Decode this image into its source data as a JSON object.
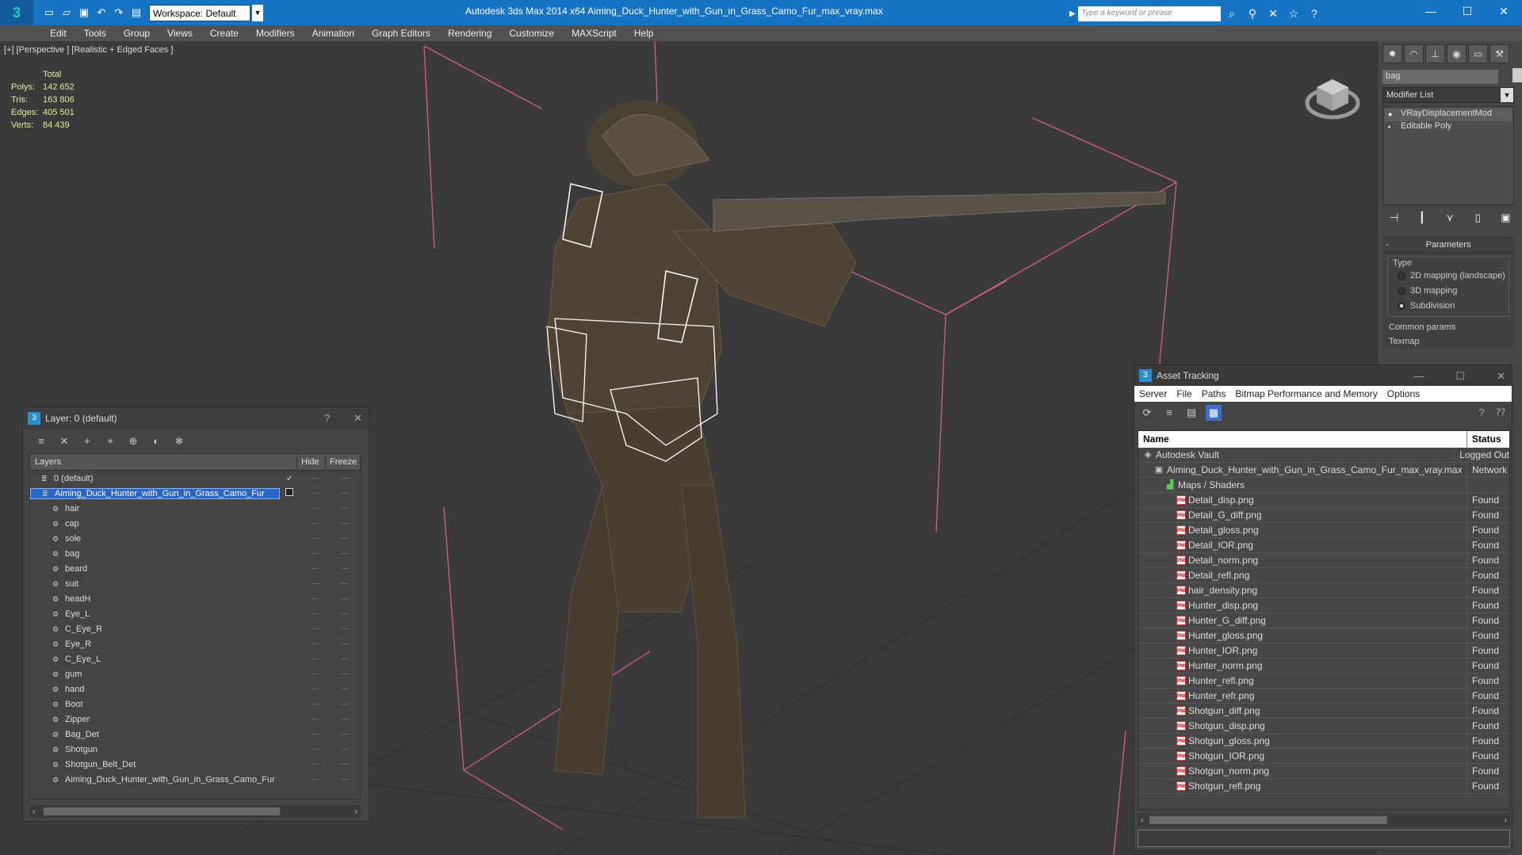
{
  "app": {
    "title": "Autodesk 3ds Max  2014 x64     Aiming_Duck_Hunter_with_Gun_in_Grass_Camo_Fur_max_vray.max",
    "logo_glyph": "3",
    "workspace": "Workspace: Default",
    "search_placeholder": "Type a keyword or phrase"
  },
  "menu": [
    "Edit",
    "Tools",
    "Group",
    "Views",
    "Create",
    "Modifiers",
    "Animation",
    "Graph Editors",
    "Rendering",
    "Customize",
    "MAXScript",
    "Help"
  ],
  "viewport": {
    "label": "[+] [Perspective ] [Realistic + Edged Faces ]",
    "stats": {
      "total_label": "Total",
      "rows": [
        {
          "k": "Polys:",
          "v": "142 652"
        },
        {
          "k": "Tris:",
          "v": "163 806"
        },
        {
          "k": "Edges:",
          "v": "405 501"
        },
        {
          "k": "Verts:",
          "v": "84 439"
        }
      ]
    }
  },
  "command_panel": {
    "object_name": "bag",
    "modifier_list": "Modifier List",
    "stack": [
      "VRayDisplacementMod",
      "Editable Poly"
    ],
    "params_title": "Parameters",
    "type_label": "Type",
    "radios": [
      {
        "label": "2D mapping (landscape)",
        "on": false
      },
      {
        "label": "3D mapping",
        "on": false
      },
      {
        "label": "Subdivision",
        "on": true
      }
    ],
    "common_params": "Common params",
    "texmap": "Texmap"
  },
  "layer_window": {
    "title": "Layer: 0 (default)",
    "help": "?",
    "close": "✕",
    "col_layers": "Layers",
    "col_hide": "Hide",
    "col_freeze": "Freeze",
    "rows": [
      {
        "name": "0 (default)",
        "level": 1,
        "check": "✓",
        "selected": false
      },
      {
        "name": "Aiming_Duck_Hunter_with_Gun_in_Grass_Camo_Fur",
        "level": 1,
        "check": "box",
        "selected": true
      },
      {
        "name": "hair",
        "level": 2
      },
      {
        "name": "cap",
        "level": 2
      },
      {
        "name": "sole",
        "level": 2
      },
      {
        "name": "bag",
        "level": 2
      },
      {
        "name": "beard",
        "level": 2
      },
      {
        "name": "suit",
        "level": 2
      },
      {
        "name": "headH",
        "level": 2
      },
      {
        "name": "Eye_L",
        "level": 2
      },
      {
        "name": "C_Eye_R",
        "level": 2
      },
      {
        "name": "Eye_R",
        "level": 2
      },
      {
        "name": "C_Eye_L",
        "level": 2
      },
      {
        "name": "gum",
        "level": 2
      },
      {
        "name": "hand",
        "level": 2
      },
      {
        "name": "Boot",
        "level": 2
      },
      {
        "name": "Zipper",
        "level": 2
      },
      {
        "name": "Bag_Det",
        "level": 2
      },
      {
        "name": "Shotgun",
        "level": 2
      },
      {
        "name": "Shotgun_Belt_Det",
        "level": 2
      },
      {
        "name": "Aiming_Duck_Hunter_with_Gun_in_Grass_Camo_Fur",
        "level": 2
      }
    ]
  },
  "asset_window": {
    "title": "Asset Tracking",
    "menu": [
      "Server",
      "File",
      "Paths",
      "Bitmap Performance and Memory",
      "Options"
    ],
    "col_name": "Name",
    "col_status": "Status",
    "rows": [
      {
        "name": "Autodesk Vault",
        "status": "Logged Out",
        "kind": "vault",
        "level": 1
      },
      {
        "name": "Aiming_Duck_Hunter_with_Gun_in_Grass_Camo_Fur_max_vray.max",
        "status": "Network",
        "kind": "max",
        "level": 2
      },
      {
        "name": "Maps / Shaders",
        "status": "",
        "kind": "maps",
        "level": 3
      },
      {
        "name": "Detail_disp.png",
        "status": "Found",
        "kind": "png",
        "level": 4
      },
      {
        "name": "Detail_G_diff.png",
        "status": "Found",
        "kind": "png",
        "level": 4
      },
      {
        "name": "Detail_gloss.png",
        "status": "Found",
        "kind": "png",
        "level": 4
      },
      {
        "name": "Detail_IOR.png",
        "status": "Found",
        "kind": "png",
        "level": 4
      },
      {
        "name": "Detail_norm.png",
        "status": "Found",
        "kind": "png",
        "level": 4
      },
      {
        "name": "Detail_refl.png",
        "status": "Found",
        "kind": "png",
        "level": 4
      },
      {
        "name": "hair_density.png",
        "status": "Found",
        "kind": "png",
        "level": 4
      },
      {
        "name": "Hunter_disp.png",
        "status": "Found",
        "kind": "png",
        "level": 4
      },
      {
        "name": "Hunter_G_diff.png",
        "status": "Found",
        "kind": "png",
        "level": 4
      },
      {
        "name": "Hunter_gloss.png",
        "status": "Found",
        "kind": "png",
        "level": 4
      },
      {
        "name": "Hunter_IOR.png",
        "status": "Found",
        "kind": "png",
        "level": 4
      },
      {
        "name": "Hunter_norm.png",
        "status": "Found",
        "kind": "png",
        "level": 4
      },
      {
        "name": "Hunter_refl.png",
        "status": "Found",
        "kind": "png",
        "level": 4
      },
      {
        "name": "Hunter_refr.png",
        "status": "Found",
        "kind": "png",
        "level": 4
      },
      {
        "name": "Shotgun_diff.png",
        "status": "Found",
        "kind": "png",
        "level": 4
      },
      {
        "name": "Shotgun_disp.png",
        "status": "Found",
        "kind": "png",
        "level": 4
      },
      {
        "name": "Shotgun_gloss.png",
        "status": "Found",
        "kind": "png",
        "level": 4
      },
      {
        "name": "Shotgun_IOR.png",
        "status": "Found",
        "kind": "png",
        "level": 4
      },
      {
        "name": "Shotgun_norm.png",
        "status": "Found",
        "kind": "png",
        "level": 4
      },
      {
        "name": "Shotgun_refl.png",
        "status": "Found",
        "kind": "png",
        "level": 4
      }
    ]
  },
  "colors": {
    "title_bar": "#1773c4",
    "selection": "#2a66c8",
    "bbox": "#d06080",
    "stats": "#e8e8a0"
  }
}
